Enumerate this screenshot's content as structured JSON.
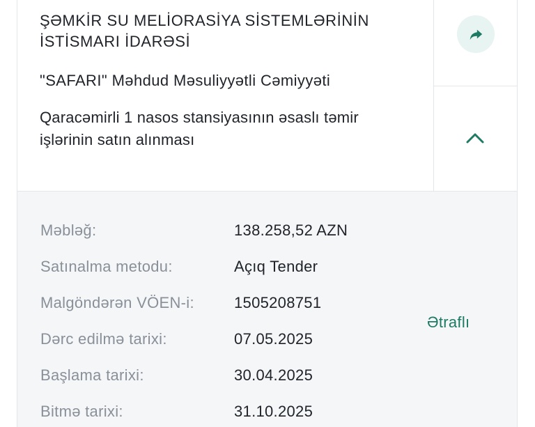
{
  "tender": {
    "organization": "ŞƏMKİR SU MELİORASİYA SİSTEMLƏRİNİN İSTİSMARI İDARƏSİ",
    "company": "\"SAFARI\" Məhdud Məsuliyyətli Cəmiyyəti",
    "subject": "Qaracəmirli 1 nasos stansiyasının əsaslı təmir işlərinin satın alınması"
  },
  "actions": {
    "share_icon": "share-forward-icon",
    "collapse_icon": "chevron-up-icon",
    "accent_color": "#1d7a63",
    "share_bg_color": "#e8f4f1"
  },
  "details": {
    "rows": [
      {
        "label": "Məbləğ:",
        "value": "138.258,52 AZN"
      },
      {
        "label": "Satınalma metodu:",
        "value": "Açıq Tender"
      },
      {
        "label": "Malgöndərən VÖEN-i:",
        "value": "1505208751"
      },
      {
        "label": "Dərc edilmə tarixi:",
        "value": "07.05.2025"
      },
      {
        "label": "Başlama tarixi:",
        "value": "30.04.2025"
      },
      {
        "label": "Bitmə tarixi:",
        "value": "31.10.2025"
      }
    ],
    "more_label": "Ətraflı"
  }
}
